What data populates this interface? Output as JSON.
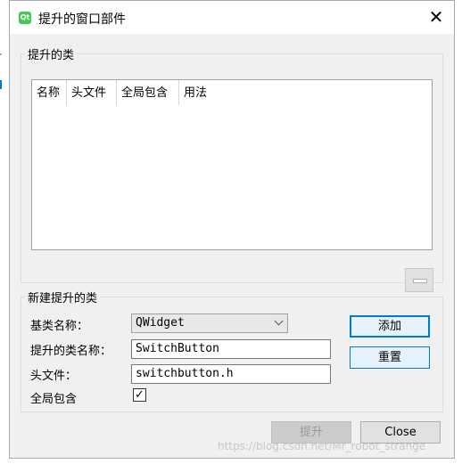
{
  "window": {
    "title": "提升的窗口部件",
    "icon_label": "Qt",
    "close_glyph": "✕"
  },
  "promoted_group": {
    "title": "提升的类",
    "columns": [
      "名称",
      "头文件",
      "全局包含",
      "用法"
    ],
    "rows": []
  },
  "new_group": {
    "title": "新建提升的类",
    "base_class_label": "基类名称：",
    "base_class_value": "QWidget",
    "class_name_label": "提升的类名称：",
    "class_name_value": "SwitchButton",
    "header_label": "头文件：",
    "header_value": "switchbutton.h",
    "global_include_label": "全局包含",
    "global_include_checked": true,
    "add_label": "添加",
    "reset_label": "重置"
  },
  "footer": {
    "promote_label": "提升",
    "close_label": "Close"
  },
  "watermark": "https://blog.csdn.net/Mr_robot_strange",
  "colors": {
    "accent": "#0078d7",
    "qt_green": "#41cd52"
  }
}
